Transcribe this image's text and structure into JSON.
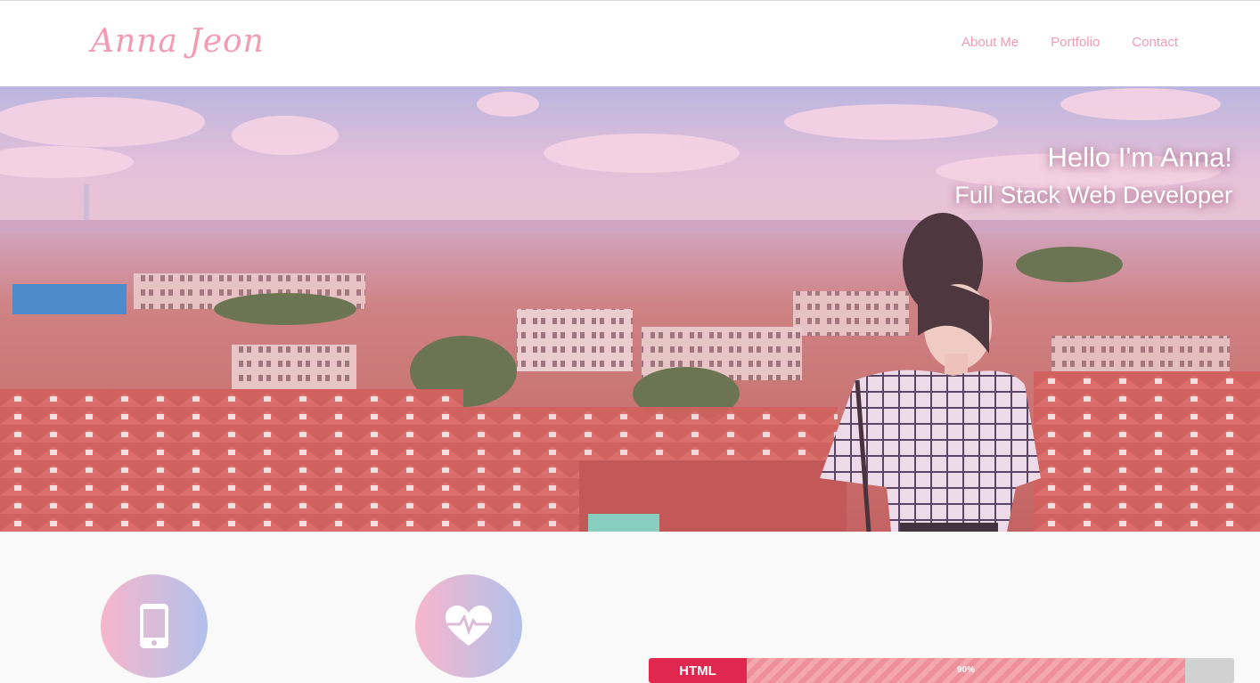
{
  "header": {
    "logo_text": "Anna Jeon",
    "nav": [
      {
        "label": "About Me"
      },
      {
        "label": "Portfolio"
      },
      {
        "label": "Contact"
      }
    ]
  },
  "hero": {
    "title": "Hello I'm Anna!",
    "subtitle": "Full Stack Web Developer"
  },
  "features": [
    {
      "icon": "mobile-phone-icon"
    },
    {
      "icon": "heartbeat-icon"
    }
  ],
  "skills": [
    {
      "label": "HTML",
      "percent_text": "90%",
      "percent": 90
    }
  ],
  "colors": {
    "accent_pink": "#f39bb3",
    "skill_label": "#e0284e",
    "skill_fill": "#ee8f99",
    "skill_track": "#d1d1d1",
    "circle_start": "#f7b6cb",
    "circle_end": "#b1c1ec"
  }
}
